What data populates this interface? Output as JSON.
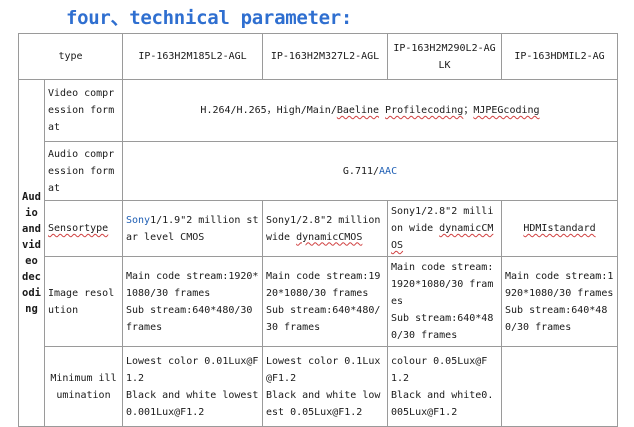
{
  "title": "four、technical parameter:",
  "header": {
    "type_label": "type",
    "models": [
      "IP-163H2M185L2-AGL",
      "IP-163H2M327L2-AGL",
      "IP-163H2M290L2-AGLK",
      "IP-163HDMIL2-AG"
    ]
  },
  "group_label": "Audio and video decoding",
  "rows": {
    "video": {
      "label": "Video compression format",
      "value_a": "H.264/H.265，High/Main/",
      "value_b": "Baeline",
      "value_c": " ",
      "value_d": "Profilecoding",
      "value_e": "；",
      "value_f": "MJPEGcoding"
    },
    "audio": {
      "label": "Audio compression format",
      "value_a": "G.711/",
      "value_b": "AAC"
    },
    "sensor": {
      "label": "Sensortype",
      "c1_a": "Sony",
      "c1_b": "1/1.9\"2 million star level CMOS",
      "c2_a": "Sony1/2.8\"2 million wide ",
      "c2_b": "dynamicCMOS",
      "c3_a": "Sony1/2.8\"2 million wide ",
      "c3_b": "dynamicCMOS",
      "c4": "HDMIstandard"
    },
    "resolution": {
      "label": "Image resolution",
      "c1_main": "Main code stream:1920*1080/30 frames",
      "c1_sub": "Sub stream:640*480/30 frames",
      "c2_main": "Main code stream:1920*1080/30 frames",
      "c2_sub": "Sub stream:640*480/30 frames",
      "c3_main": "Main code stream:1920*1080/30 frames",
      "c3_sub": "Sub stream:640*480/30 frames",
      "c4_main": "Main code stream:1920*1080/30 frames",
      "c4_sub": "Sub stream:640*480/30 frames"
    },
    "illumination": {
      "label": "Minimum illumination",
      "c1_color": "Lowest color  0.01Lux@F1.2",
      "c1_bw": "Black and white lowest  0.001Lux@F1.2",
      "c2_color": "Lowest color  0.1Lux@F1.2",
      "c2_bw": "Black and white lowest  0.05Lux@F1.2",
      "c3_color": "colour  0.05Lux@F1.2",
      "c3_bw": "Black and white0.005Lux@F1.2"
    }
  }
}
